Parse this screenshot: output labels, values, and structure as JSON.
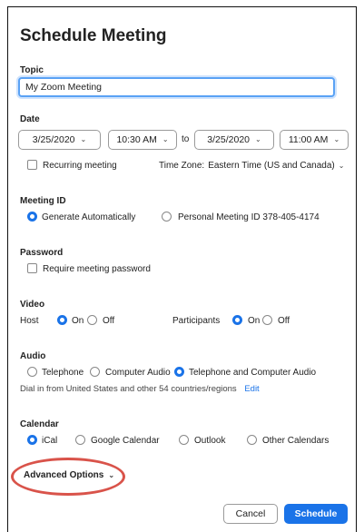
{
  "title": "Schedule Meeting",
  "topic": {
    "label": "Topic",
    "value": "My Zoom Meeting"
  },
  "date": {
    "label": "Date",
    "start_date": "3/25/2020",
    "start_time": "10:30 AM",
    "to_label": "to",
    "end_date": "3/25/2020",
    "end_time": "11:00 AM",
    "recurring_label": "Recurring meeting",
    "timezone_label": "Time Zone:",
    "timezone_value": "Eastern Time (US and Canada)"
  },
  "meeting_id": {
    "label": "Meeting ID",
    "options": [
      "Generate Automatically",
      "Personal Meeting ID 378-405-4174"
    ],
    "selected": "Generate Automatically"
  },
  "password": {
    "label": "Password",
    "require_label": "Require meeting password"
  },
  "video": {
    "label": "Video",
    "host_label": "Host",
    "participants_label": "Participants",
    "on_label": "On",
    "off_label": "Off",
    "host_selected": "On",
    "participants_selected": "On"
  },
  "audio": {
    "label": "Audio",
    "options": [
      "Telephone",
      "Computer Audio",
      "Telephone and Computer Audio"
    ],
    "selected": "Telephone and Computer Audio",
    "dial_in_text": "Dial in from United States and other 54 countries/regions",
    "edit_label": "Edit"
  },
  "calendar": {
    "label": "Calendar",
    "options": [
      "iCal",
      "Google Calendar",
      "Outlook",
      "Other Calendars"
    ],
    "selected": "iCal"
  },
  "advanced_options_label": "Advanced Options",
  "buttons": {
    "cancel": "Cancel",
    "schedule": "Schedule"
  },
  "colors": {
    "accent": "#1a73e8",
    "highlight_ring": "#d9534a",
    "focus_border": "#5aa2f5"
  },
  "icons": {
    "dropdown": "chevron-down-icon"
  }
}
